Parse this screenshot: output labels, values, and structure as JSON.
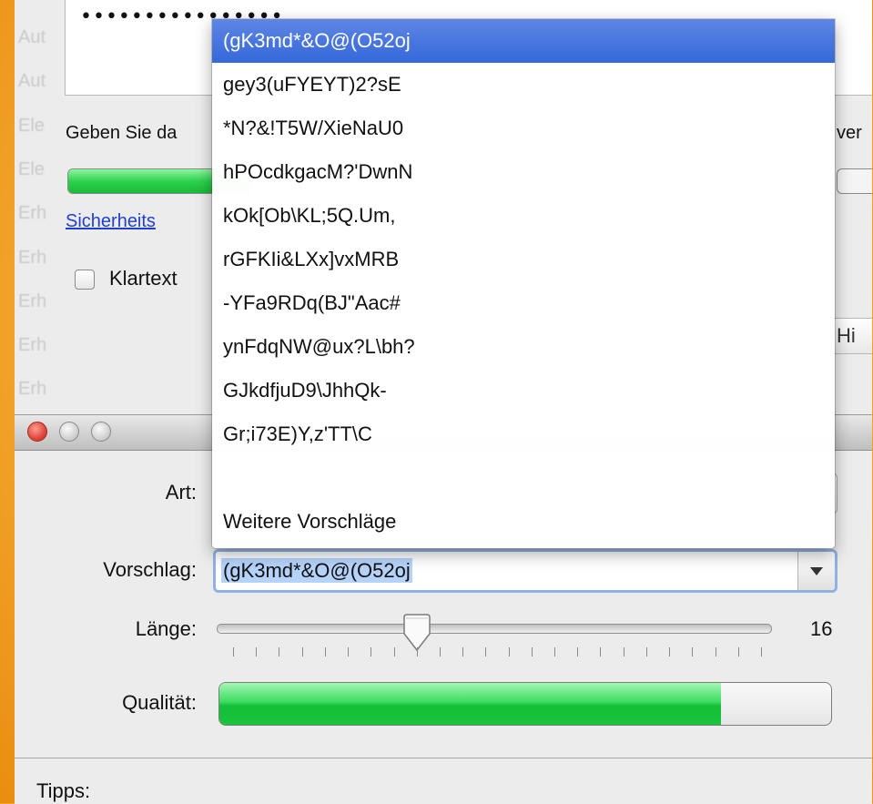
{
  "background_window": {
    "password_masked": "••••••••••••••••",
    "hint_text_prefix": "Geben Sie da",
    "hint_text_suffix": "ver",
    "security_link": "Sicherheits",
    "checkbox_label": "Klartext",
    "hint_button": "Hi",
    "ghost_labels": [
      "Aut",
      "Aut",
      "Ele",
      "Ele",
      "Erh",
      "Erh",
      "Erh",
      "Erh",
      "Erh"
    ]
  },
  "assistant": {
    "labels": {
      "art": "Art:",
      "vorschlag": "Vorschlag:",
      "laenge": "Länge:",
      "qualitaet": "Qualität:",
      "tipps": "Tipps:"
    },
    "vorschlag_value": "(gK3md*&O@(O52oj",
    "length_value": "16",
    "length_min": 8,
    "length_max": 31,
    "quality_fraction": 0.82
  },
  "suggestions": {
    "items": [
      "(gK3md*&O@(O52oj",
      "gey3(uFYEYT)2?sE",
      "*N?&!T5W/XieNaU0",
      "hPOcdkgacM?'DwnN",
      "kOk[Ob\\KL;5Q.Um,",
      "rGFKIi&LXx]vxMRB",
      "-YFa9RDq(BJ\"Aac#",
      "ynFdqNW@ux?L\\bh?",
      "GJkdfjuD9\\JhhQk-",
      "Gr;i73E)Y,z'TT\\C"
    ],
    "selected_index": 0,
    "more": "Weitere Vorschläge"
  },
  "colors": {
    "selection": "#3b6bdc",
    "meter_green": "#2fd24e",
    "link_blue": "#1f3fd0",
    "desktop": "#f2a422"
  }
}
